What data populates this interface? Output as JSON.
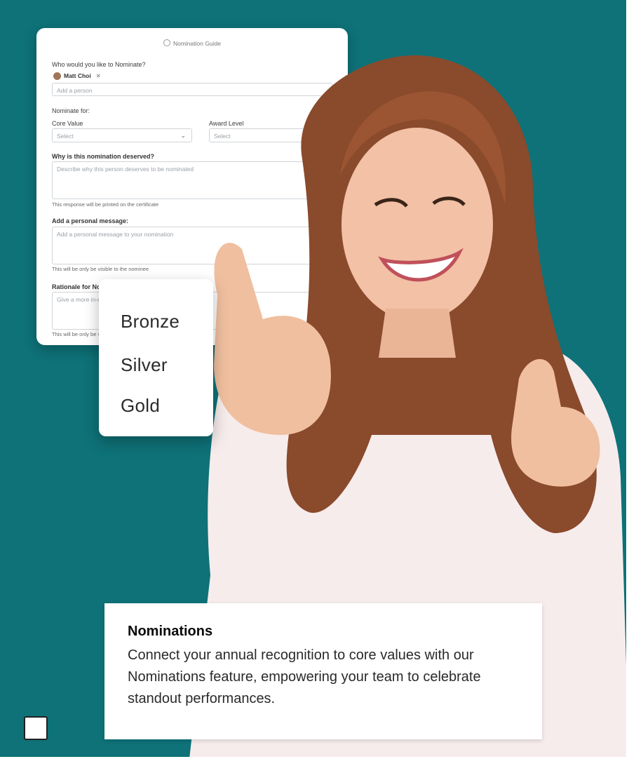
{
  "form": {
    "guide_label": "Nomination Guide",
    "who_label": "Who would you like to Nominate?",
    "nominee_chip": "Matt Choi",
    "add_person_placeholder": "Add a person",
    "nominate_for_label": "Nominate for:",
    "core_value_label": "Core Value",
    "core_value_select": "Select",
    "award_level_label": "Award Level",
    "award_level_select": "Select",
    "why_label": "Why is this nomination deserved?",
    "why_placeholder": "Describe why this person deserves to be nominated",
    "why_hint": "This response will be printed on the certificate",
    "message_label": "Add a personal message:",
    "message_placeholder": "Add a personal message to your nomination",
    "message_hint": "This will be only be visible to the nominee",
    "rationale_label": "Rationale for Nomi",
    "rationale_placeholder": "Give a more in-de",
    "rationale_hint": "This will be only be v"
  },
  "award_dropdown": {
    "options": [
      "Bronze",
      "Silver",
      "Gold"
    ]
  },
  "caption": {
    "title": "Nominations",
    "body": "Connect your annual recognition to core values with our Nominations feature, empowering your team to celebrate standout performances."
  },
  "colors": {
    "background": "#0e7278",
    "card": "#ffffff",
    "text": "#0a0a0a"
  },
  "icons": [
    "info-icon",
    "avatar",
    "remove-icon",
    "chevron-down-icon"
  ]
}
